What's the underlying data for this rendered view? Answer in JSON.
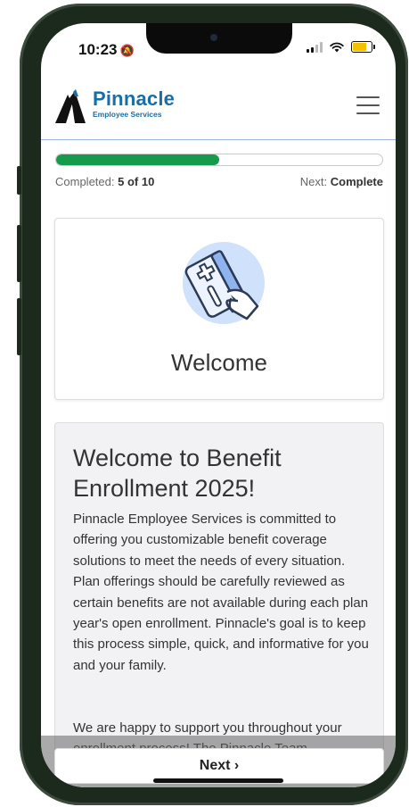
{
  "status": {
    "time": "10:23",
    "silent_icon": "bell-slash-icon"
  },
  "header": {
    "brand_name": "Pinnacle",
    "brand_sub": "Employee Services",
    "menu_icon": "hamburger-menu-icon"
  },
  "progress": {
    "completed_prefix": "Completed:",
    "completed_value": "5 of 10",
    "next_prefix": "Next:",
    "next_value": "Complete",
    "fraction": 0.5,
    "color": "#169b4c"
  },
  "welcome_card": {
    "title": "Welcome",
    "illustration": "hand-holding-insurance-card-icon"
  },
  "intro": {
    "heading": "Welcome to Benefit Enrollment 2025!",
    "paragraph1": "Pinnacle Employee Services is committed to offering you customizable benefit coverage solutions to meet the needs of every situation. Plan offerings should be carefully reviewed as certain benefits are not available during each plan year's open enrollment. Pinnacle's goal is to keep this process simple, quick, and informative for you and your family.",
    "paragraph2": "We are happy to support you throughout your enrollment process! The Pinnacle Team"
  },
  "footer": {
    "next_button": "Next ›"
  },
  "colors": {
    "brand": "#1a6ea6",
    "divider": "#9db2e0"
  }
}
